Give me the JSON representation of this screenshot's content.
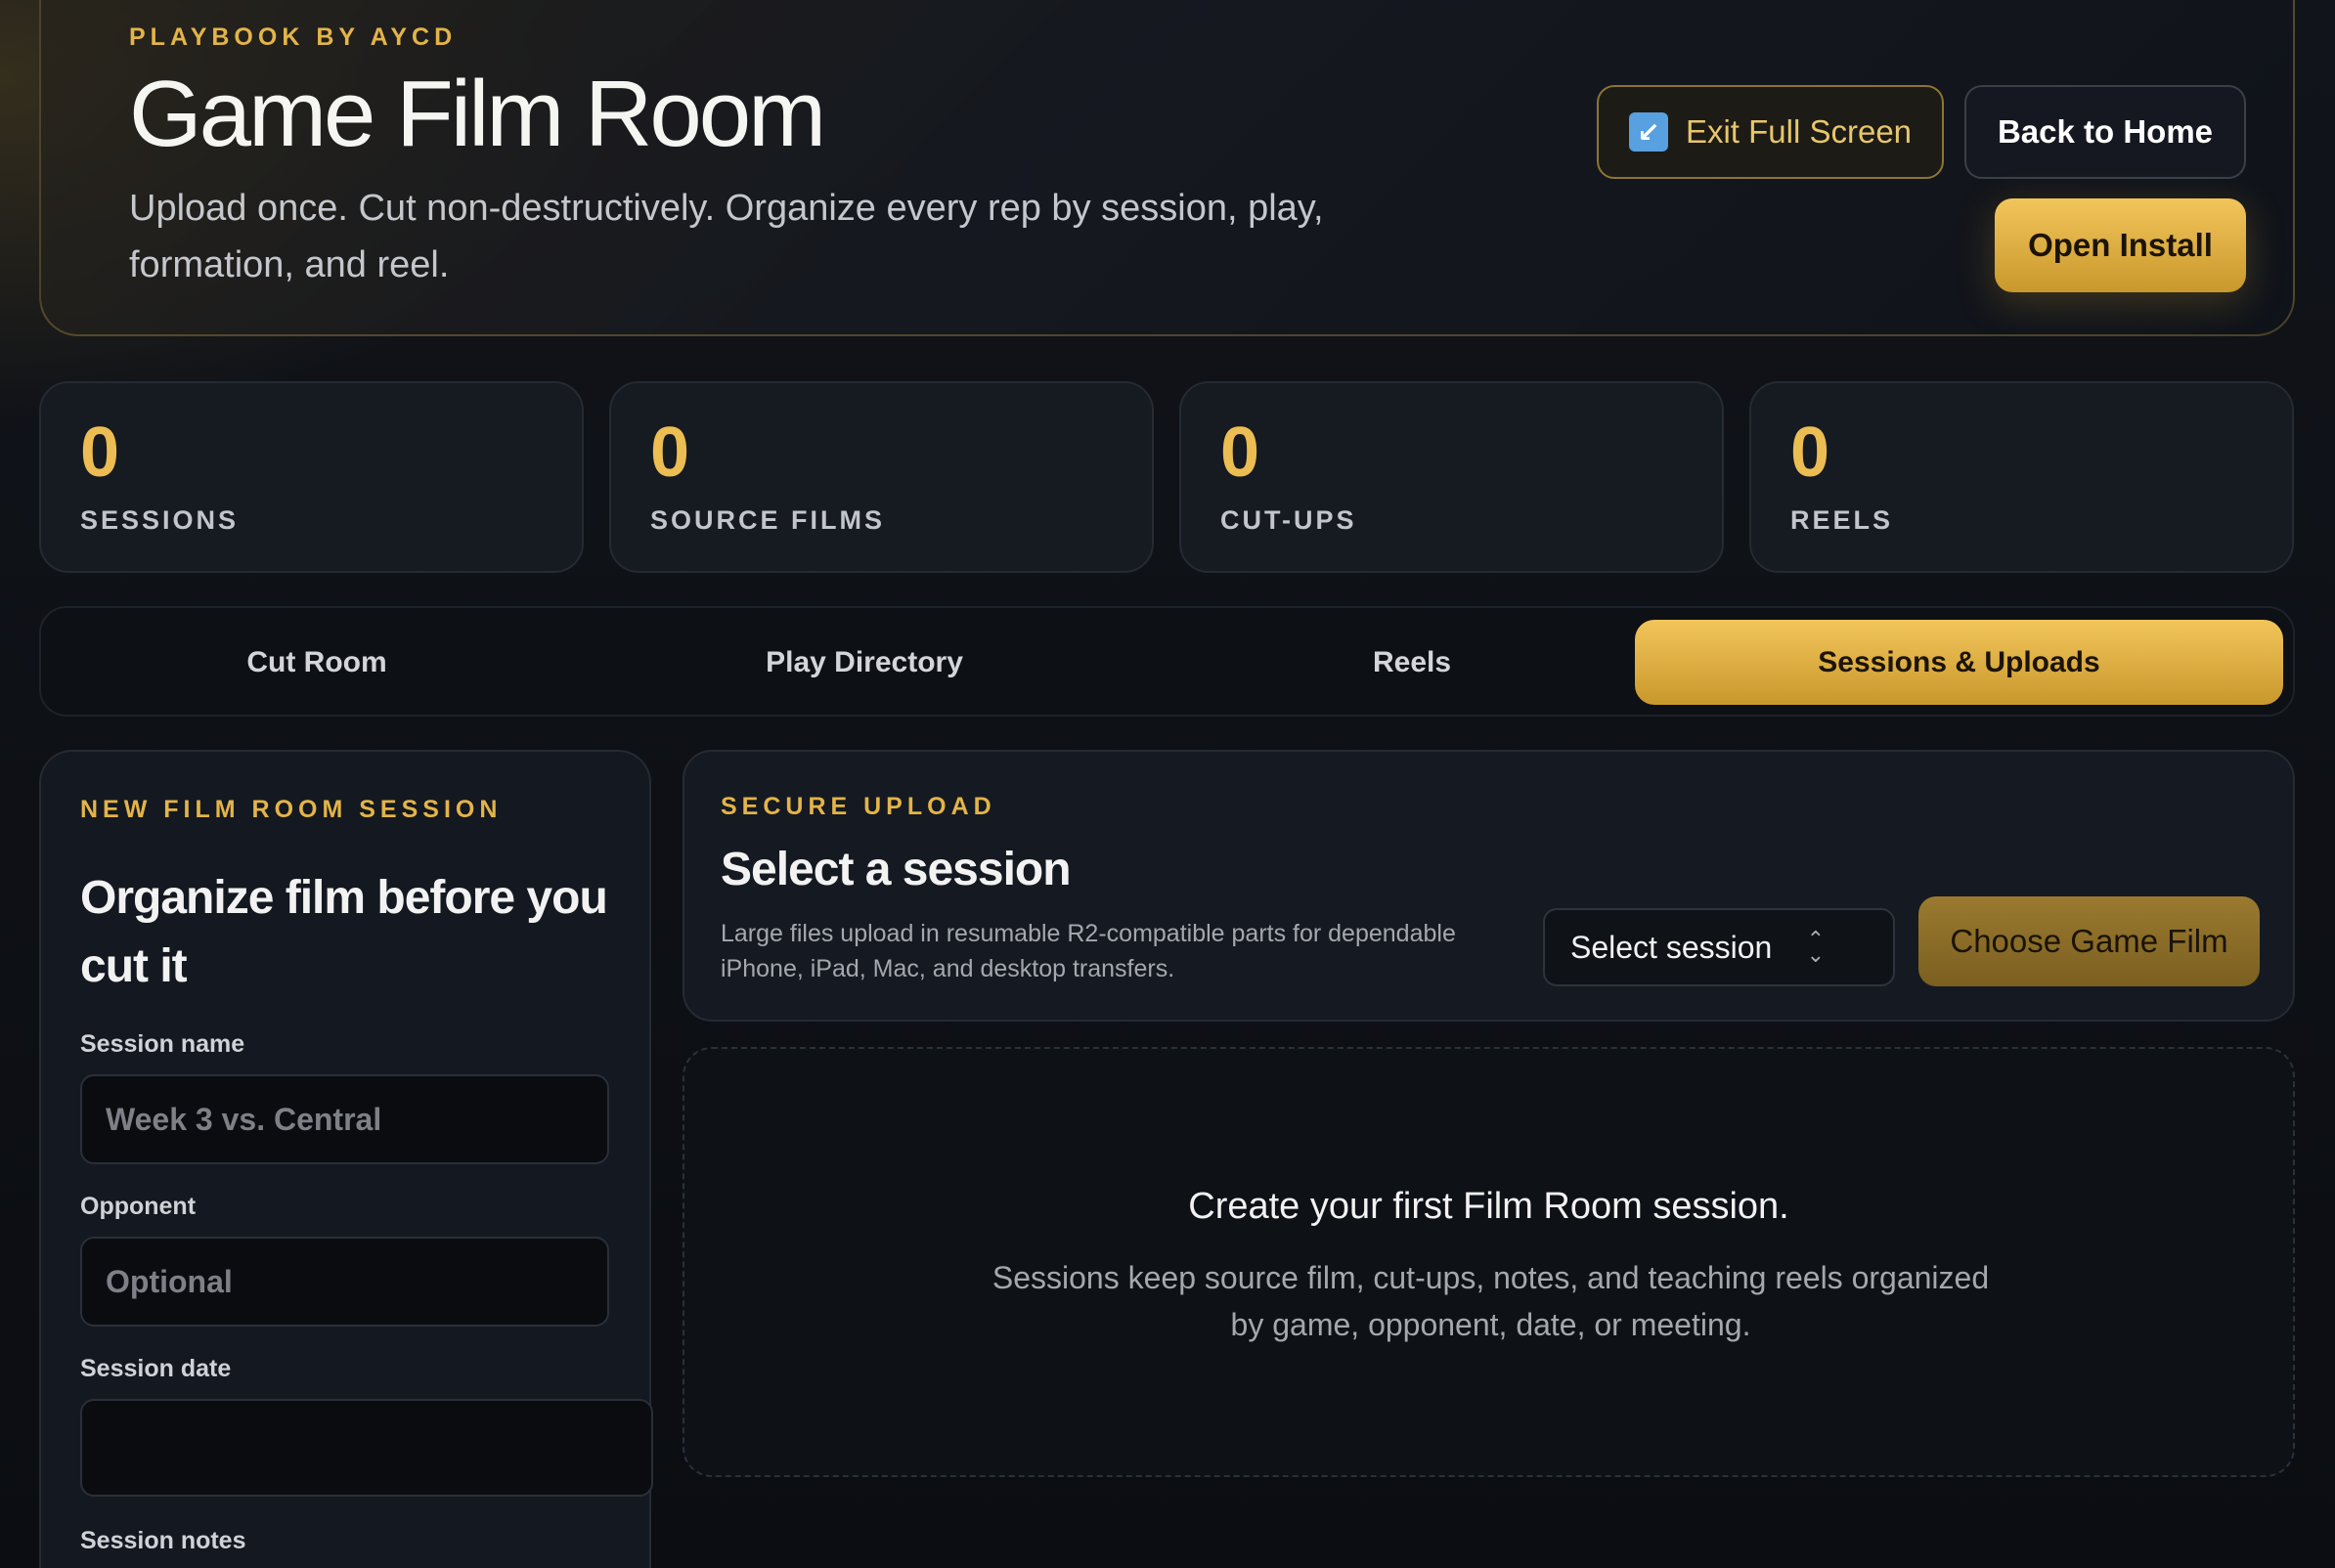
{
  "header": {
    "eyebrow": "PLAYBOOK BY AYCD",
    "title": "Game Film Room",
    "subtitle": "Upload once. Cut non-destructively. Organize every rep by session, play, formation, and reel.",
    "exit_full_screen_label": "Exit Full Screen",
    "exit_icon": "exit-fullscreen-arrow-icon",
    "back_to_home_label": "Back to Home",
    "open_install_label": "Open Install"
  },
  "stats": [
    {
      "value": "0",
      "label": "SESSIONS"
    },
    {
      "value": "0",
      "label": "SOURCE FILMS"
    },
    {
      "value": "0",
      "label": "CUT-UPS"
    },
    {
      "value": "0",
      "label": "REELS"
    }
  ],
  "tabs": [
    {
      "label": "Cut Room",
      "active": false
    },
    {
      "label": "Play Directory",
      "active": false
    },
    {
      "label": "Reels",
      "active": false
    },
    {
      "label": "Sessions & Uploads",
      "active": true
    }
  ],
  "new_session": {
    "eyebrow": "NEW FILM ROOM SESSION",
    "title": "Organize film before you cut it",
    "session_name_label": "Session name",
    "session_name_placeholder": "Week 3 vs. Central",
    "opponent_label": "Opponent",
    "opponent_placeholder": "Optional",
    "session_date_label": "Session date",
    "session_date_value": "",
    "session_notes_label": "Session notes"
  },
  "upload": {
    "eyebrow": "SECURE UPLOAD",
    "title": "Select a session",
    "description": "Large files upload in resumable R2-compatible parts for dependable iPhone, iPad, Mac, and desktop transfers.",
    "select_value": "Select session",
    "choose_button_label": "Choose Game Film"
  },
  "empty_state": {
    "title": "Create your first Film Room session.",
    "description": "Sessions keep source film, cut-ups, notes, and teaching reels organized by game, opponent, date, or meeting."
  },
  "colors": {
    "accent": "#e3b448",
    "background": "#0b0d11",
    "panel": "#151921"
  }
}
